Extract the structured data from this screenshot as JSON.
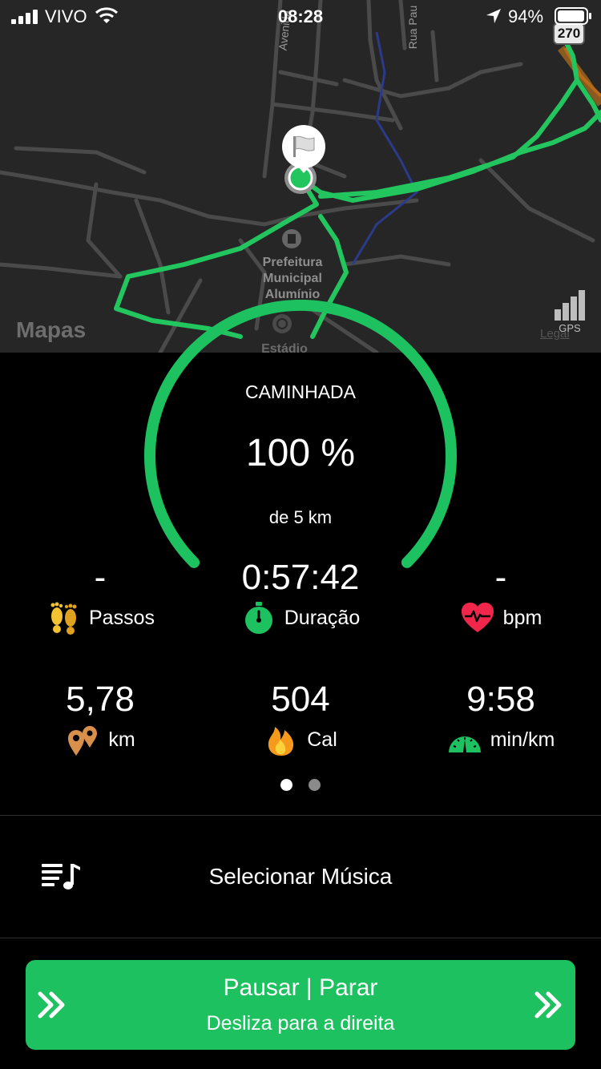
{
  "status_bar": {
    "carrier": "VIVO",
    "time": "08:28",
    "battery_percent": "94%"
  },
  "map": {
    "place_label": "Prefeitura\nMunicipal\nAlumínio",
    "place_label_line1": "Prefeitura",
    "place_label_line2": "Municipal",
    "place_label_line3": "Alumínio",
    "stadium_label": "Estádio",
    "street_avenida": "Avenida",
    "street_rua": "Rua Pau",
    "route_shield": "270",
    "brand": "Mapas",
    "legal": "Legal",
    "gps_label": "GPS",
    "route_color": "#22c55e"
  },
  "progress": {
    "activity": "CAMINHADA",
    "percent_text": "100 %",
    "percent": 100,
    "goal_text": "de 5 km"
  },
  "stats": {
    "steps": {
      "value": "-",
      "label": "Passos",
      "icon": "footprints-icon"
    },
    "duration": {
      "value": "0:57:42",
      "label": "Duração",
      "icon": "stopwatch-icon"
    },
    "heart_rate": {
      "value": "-",
      "label": "bpm",
      "icon": "heart-rate-icon"
    },
    "distance": {
      "value": "5,78",
      "label": "km",
      "icon": "location-pins-icon"
    },
    "calories": {
      "value": "504",
      "label": "Cal",
      "icon": "flame-icon"
    },
    "pace": {
      "value": "9:58",
      "label": "min/km",
      "icon": "speedometer-icon"
    }
  },
  "pager": {
    "pages": 2,
    "active": 0
  },
  "music": {
    "label": "Selecionar Música",
    "icon": "music-playlist-icon"
  },
  "slide_button": {
    "title": "Pausar | Parar",
    "subtitle": "Desliza para a direita",
    "color": "#1ec15f"
  }
}
